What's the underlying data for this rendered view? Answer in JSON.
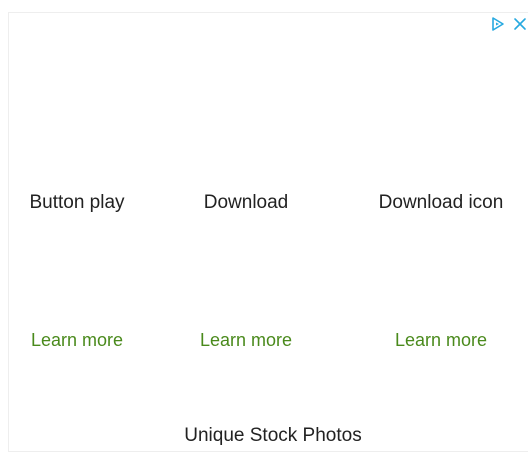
{
  "ad": {
    "controls": {
      "adchoices_icon": "adchoices-play-icon",
      "close_icon": "close-icon",
      "accent_color": "#27a9e0"
    },
    "items": [
      {
        "title": "Button play",
        "cta": "Learn more"
      },
      {
        "title": "Download",
        "cta": "Learn more"
      },
      {
        "title": "Download icon",
        "cta": "Learn more"
      }
    ],
    "footer": {
      "title": "Unique Stock Photos"
    },
    "colors": {
      "cta": "#4a8a1c",
      "text": "#222222"
    }
  }
}
